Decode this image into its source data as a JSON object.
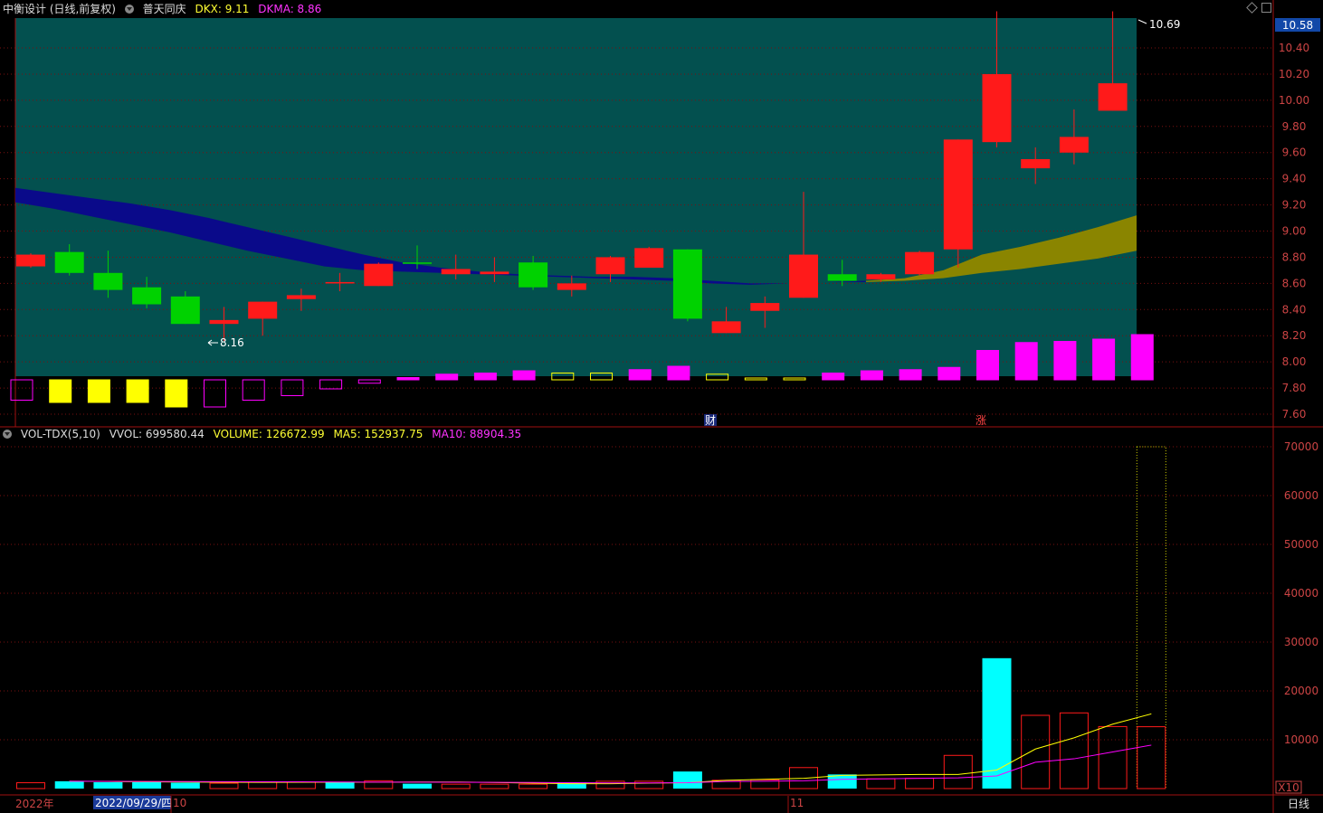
{
  "header": {
    "stock_title": "中衡设计 (日线,前复权)",
    "indicator_name": "普天同庆",
    "dkx_label": "DKX: 9.11",
    "dkma_label": "DKMA: 8.86",
    "vol_indicator": "VOL-TDX(5,10)",
    "vvol_label": "VVOL: 699580.44",
    "volume_label": "VOLUME: 126672.99",
    "ma5_label": "MA5: 152937.75",
    "ma10_label": "MA10: 88904.35"
  },
  "colors": {
    "up": "#ff1a1a",
    "down": "#00d200",
    "teal_bg": "#03504f",
    "band_blue": "#0a0a8a",
    "band_olive": "#8a8500",
    "magenta": "#ff00ff",
    "yellow": "#ffff00",
    "cyan": "#00ffff",
    "grid": "#7a1010"
  },
  "labels": {
    "high_marker": "10.69",
    "low_marker": "8.16",
    "current_price": "10.58",
    "event_cai": "财",
    "event_zhang": "涨",
    "year": "2022年",
    "date_cursor": "2022/09/29/四",
    "month_10": "10",
    "month_11": "11",
    "period": "日线",
    "x10": "X10"
  },
  "chart_data": [
    {
      "type": "candlestick",
      "title": "中衡设计 (日线,前复权)",
      "y_ticks": [
        7.6,
        7.8,
        8.0,
        8.2,
        8.4,
        8.6,
        8.8,
        9.0,
        9.2,
        9.4,
        9.6,
        9.8,
        10.0,
        10.2,
        10.4,
        10.58
      ],
      "ylim": [
        7.54,
        10.7
      ],
      "candles": [
        {
          "o": 8.73,
          "h": 8.83,
          "l": 8.72,
          "c": 8.82
        },
        {
          "o": 8.84,
          "h": 8.9,
          "l": 8.66,
          "c": 8.68
        },
        {
          "o": 8.68,
          "h": 8.85,
          "l": 8.49,
          "c": 8.55
        },
        {
          "o": 8.57,
          "h": 8.65,
          "l": 8.41,
          "c": 8.44
        },
        {
          "o": 8.5,
          "h": 8.54,
          "l": 8.29,
          "c": 8.29
        },
        {
          "o": 8.29,
          "h": 8.42,
          "l": 8.16,
          "c": 8.32
        },
        {
          "o": 8.33,
          "h": 8.46,
          "l": 8.2,
          "c": 8.46
        },
        {
          "o": 8.48,
          "h": 8.56,
          "l": 8.39,
          "c": 8.51
        },
        {
          "o": 8.61,
          "h": 8.68,
          "l": 8.54,
          "c": 8.61
        },
        {
          "o": 8.58,
          "h": 8.76,
          "l": 8.58,
          "c": 8.75
        },
        {
          "o": 8.76,
          "h": 8.89,
          "l": 8.71,
          "c": 8.75
        },
        {
          "o": 8.67,
          "h": 8.82,
          "l": 8.63,
          "c": 8.71
        },
        {
          "o": 8.67,
          "h": 8.8,
          "l": 8.61,
          "c": 8.69
        },
        {
          "o": 8.76,
          "h": 8.81,
          "l": 8.55,
          "c": 8.57
        },
        {
          "o": 8.55,
          "h": 8.66,
          "l": 8.5,
          "c": 8.6
        },
        {
          "o": 8.67,
          "h": 8.81,
          "l": 8.61,
          "c": 8.8
        },
        {
          "o": 8.72,
          "h": 8.88,
          "l": 8.72,
          "c": 8.87
        },
        {
          "o": 8.86,
          "h": 8.86,
          "l": 8.31,
          "c": 8.33
        },
        {
          "o": 8.22,
          "h": 8.42,
          "l": 8.22,
          "c": 8.31
        },
        {
          "o": 8.39,
          "h": 8.5,
          "l": 8.26,
          "c": 8.45
        },
        {
          "o": 8.49,
          "h": 9.3,
          "l": 8.49,
          "c": 8.82
        },
        {
          "o": 8.67,
          "h": 8.78,
          "l": 8.58,
          "c": 8.62
        },
        {
          "o": 8.63,
          "h": 8.68,
          "l": 8.61,
          "c": 8.67
        },
        {
          "o": 8.67,
          "h": 8.85,
          "l": 8.66,
          "c": 8.84
        },
        {
          "o": 8.86,
          "h": 9.7,
          "l": 8.72,
          "c": 9.7
        },
        {
          "o": 9.68,
          "h": 10.68,
          "l": 9.64,
          "c": 10.2
        },
        {
          "o": 9.48,
          "h": 9.64,
          "l": 9.36,
          "c": 9.55
        },
        {
          "o": 9.6,
          "h": 9.93,
          "l": 9.51,
          "c": 9.72
        },
        {
          "o": 9.92,
          "h": 10.68,
          "l": 9.92,
          "c": 10.13
        }
      ],
      "dkx_band": {
        "upper": [
          9.33,
          9.29,
          9.25,
          9.21,
          9.16,
          9.1,
          9.03,
          8.96,
          8.89,
          8.82,
          8.76,
          8.72,
          8.69,
          8.67,
          8.66,
          8.65,
          8.65,
          8.64,
          8.62,
          8.6,
          8.6,
          8.61,
          8.62,
          8.64,
          8.7,
          8.82,
          8.88,
          8.95,
          9.03,
          9.12
        ],
        "lower": [
          9.22,
          9.17,
          9.11,
          9.05,
          8.99,
          8.92,
          8.85,
          8.79,
          8.73,
          8.7,
          8.69,
          8.68,
          8.67,
          8.66,
          8.65,
          8.64,
          8.63,
          8.62,
          8.6,
          8.59,
          8.6,
          8.61,
          8.61,
          8.62,
          8.64,
          8.68,
          8.71,
          8.75,
          8.79,
          8.85
        ],
        "olive_from": 22
      },
      "signal_bars": [
        {
          "v": -0.9,
          "color": "magenta",
          "filled": false
        },
        {
          "v": -1.0,
          "color": "yellow",
          "filled": true
        },
        {
          "v": -1.0,
          "color": "yellow",
          "filled": true
        },
        {
          "v": -1.0,
          "color": "yellow",
          "filled": true
        },
        {
          "v": -1.2,
          "color": "yellow",
          "filled": true
        },
        {
          "v": -1.2,
          "color": "magenta",
          "filled": false
        },
        {
          "v": -0.9,
          "color": "magenta",
          "filled": false
        },
        {
          "v": -0.7,
          "color": "magenta",
          "filled": false
        },
        {
          "v": -0.4,
          "color": "magenta",
          "filled": false
        },
        {
          "v": -0.15,
          "color": "magenta",
          "filled": false
        },
        {
          "v": 0.1,
          "color": "magenta",
          "filled": true
        },
        {
          "v": 0.25,
          "color": "magenta",
          "filled": true
        },
        {
          "v": 0.3,
          "color": "magenta",
          "filled": true
        },
        {
          "v": 0.4,
          "color": "magenta",
          "filled": true
        },
        {
          "v": 0.3,
          "color": "yellow",
          "filled": false
        },
        {
          "v": 0.3,
          "color": "yellow",
          "filled": false
        },
        {
          "v": 0.45,
          "color": "magenta",
          "filled": true
        },
        {
          "v": 0.6,
          "color": "magenta",
          "filled": true
        },
        {
          "v": 0.25,
          "color": "yellow",
          "filled": false
        },
        {
          "v": 0.05,
          "color": "yellow",
          "filled": false
        },
        {
          "v": 0.05,
          "color": "yellow",
          "filled": false
        },
        {
          "v": 0.3,
          "color": "magenta",
          "filled": true
        },
        {
          "v": 0.4,
          "color": "magenta",
          "filled": true
        },
        {
          "v": 0.45,
          "color": "magenta",
          "filled": true
        },
        {
          "v": 0.55,
          "color": "magenta",
          "filled": true
        },
        {
          "v": 1.3,
          "color": "magenta",
          "filled": true
        },
        {
          "v": 1.65,
          "color": "magenta",
          "filled": true
        },
        {
          "v": 1.7,
          "color": "magenta",
          "filled": true
        },
        {
          "v": 1.8,
          "color": "magenta",
          "filled": true
        },
        {
          "v": 2.0,
          "color": "magenta",
          "filled": true
        }
      ]
    },
    {
      "type": "bar",
      "title": "VOL-TDX(5,10)",
      "y_ticks": [
        10000,
        20000,
        30000,
        40000,
        50000,
        60000,
        70000
      ],
      "ylim": [
        0,
        70000
      ],
      "unit": "X10",
      "volume": [
        1200,
        1500,
        1300,
        1300,
        1200,
        1100,
        1400,
        1300,
        1300,
        1600,
        1000,
        900,
        900,
        900,
        1300,
        1500,
        1500,
        3500,
        1700,
        1800,
        4300,
        2900,
        2000,
        2100,
        6800,
        26700,
        15000,
        15500,
        12700
      ],
      "vol_down": [
        false,
        true,
        true,
        true,
        true,
        false,
        false,
        false,
        true,
        false,
        true,
        false,
        false,
        false,
        true,
        false,
        false,
        true,
        false,
        false,
        false,
        true,
        false,
        false,
        false,
        true,
        false,
        false,
        false
      ],
      "ma5": [
        1500,
        1450,
        1400,
        1350,
        1300,
        1280,
        1300,
        1300,
        1300,
        1350,
        1350,
        1250,
        1100,
        1000,
        1000,
        1100,
        1200,
        1700,
        1900,
        2100,
        2700,
        2800,
        2900,
        2900,
        3800,
        8100,
        10400,
        13200,
        15300
      ],
      "ma10": [
        1500,
        1480,
        1460,
        1440,
        1420,
        1400,
        1380,
        1350,
        1330,
        1320,
        1300,
        1280,
        1250,
        1200,
        1150,
        1150,
        1200,
        1450,
        1500,
        1600,
        1900,
        2000,
        2100,
        2200,
        2600,
        5400,
        6100,
        7500,
        8900
      ],
      "last_volume": 70000
    }
  ]
}
